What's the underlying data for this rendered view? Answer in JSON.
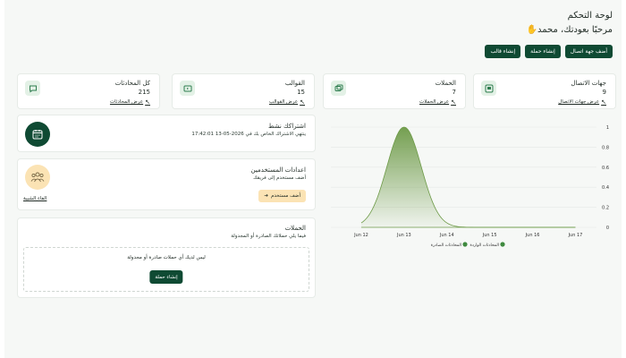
{
  "header": {
    "title": "لوحة التحكم",
    "welcome": "مرحبًا بعودتك، محمد",
    "wave_icon": "waving-hand-icon"
  },
  "actions": {
    "add_contact": "أضف جهة اتصال",
    "create_campaign": "إنشاء حملة",
    "create_template": "إنشاء قالب"
  },
  "stats": [
    {
      "label": "جهات الاتصال",
      "value": "9",
      "link": "عرض جهات الاتصال",
      "icon": "contacts-icon"
    },
    {
      "label": "الحملات",
      "value": "7",
      "link": "عرض الحملات",
      "icon": "campaigns-icon"
    },
    {
      "label": "القوالب",
      "value": "15",
      "link": "عرض القوالب",
      "icon": "templates-icon"
    },
    {
      "label": "كل المحادثات",
      "value": "215",
      "link": "عرض المحادثات",
      "icon": "chat-icon"
    }
  ],
  "subscription": {
    "title": "اشتراكك نشط",
    "detail": "ينتهي الاشتراك الخاص بك في 2026-05-13 17:42:01",
    "icon": "calendar-icon"
  },
  "users": {
    "title": "اعدادات المستخدمين",
    "subtitle": "أضف مستخدم إلى فريقك",
    "add_button": "أضف مستخدم",
    "team_link": "الفاء الشبية",
    "icon": "team-icon"
  },
  "campaigns": {
    "title": "الحملات",
    "subtitle": "فيما يلي حملاتك الصادرة أو المجدولة",
    "empty_text": "ليس لديك أي حملات صادرة أو مجدولة",
    "create_button": "إنشاء حملة"
  },
  "colors": {
    "brand": "#0f4a33",
    "accent_light": "#e3f1e6",
    "warm": "#fbe3b4",
    "chart_line": "#6d9a47"
  },
  "chart_data": {
    "type": "area",
    "x": [
      "Jun 12",
      "Jun 13",
      "Jun 14",
      "Jun 15",
      "Jun 16",
      "Jun 17"
    ],
    "ylim": [
      0,
      1
    ],
    "yticks": [
      "0",
      "0.2",
      "0.4",
      "0.6",
      "0.8",
      "1"
    ],
    "series": [
      {
        "name": "المحادثات الواردة",
        "values": [
          0,
          1,
          0,
          0,
          0,
          0
        ]
      },
      {
        "name": "المحادثات الصادرة",
        "values": [
          0,
          0,
          0,
          0,
          0,
          0
        ]
      }
    ],
    "grid": true,
    "legend": "bottom"
  }
}
